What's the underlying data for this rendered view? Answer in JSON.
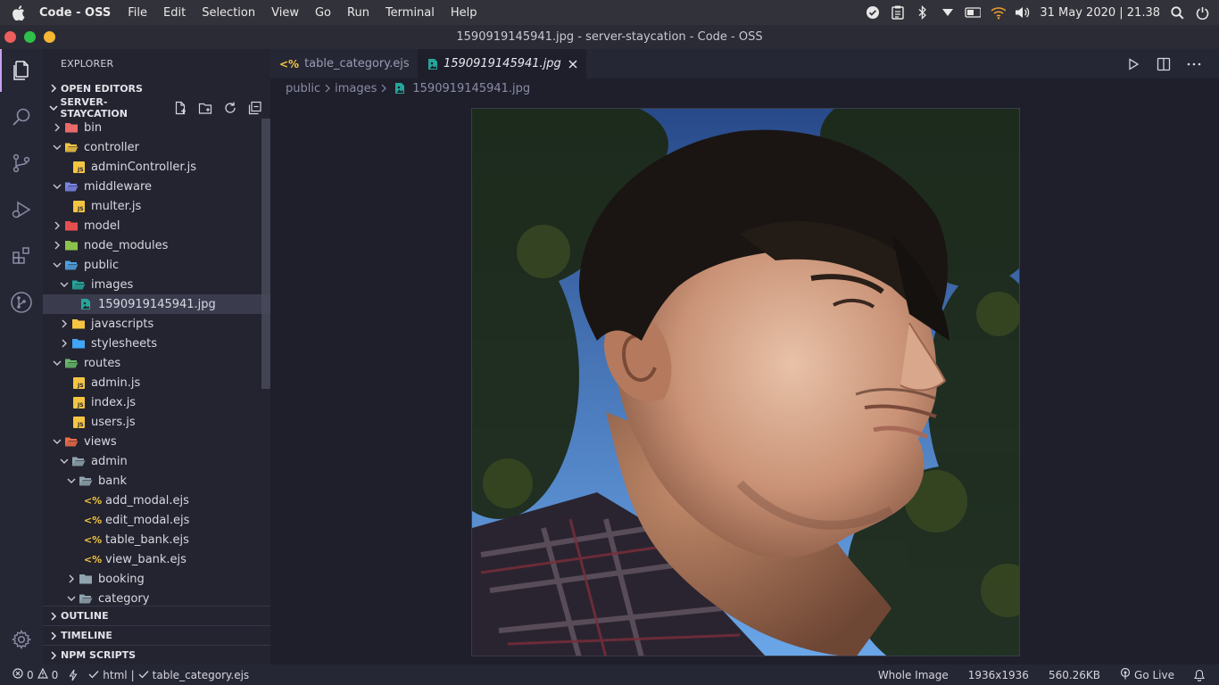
{
  "topbar": {
    "app_name": "Code - OSS",
    "menu": [
      "File",
      "Edit",
      "Selection",
      "View",
      "Go",
      "Run",
      "Terminal",
      "Help"
    ],
    "clock": "31 May 2020 | 21.38"
  },
  "window": {
    "title": "1590919145941.jpg - server-staycation - Code - OSS",
    "lights": [
      "#ee5e5c",
      "#2ec04a",
      "#f5b633"
    ]
  },
  "sidebar": {
    "title": "EXPLORER",
    "open_editors": "OPEN EDITORS",
    "project": "SERVER-STAYCATION",
    "tree": [
      {
        "label": "bin",
        "depth": 0,
        "kind": "folder",
        "open": false,
        "color": "#e96a6a"
      },
      {
        "label": "controller",
        "depth": 0,
        "kind": "folder",
        "open": true,
        "color": "#f5c542"
      },
      {
        "label": "adminController.js",
        "depth": 1,
        "kind": "js"
      },
      {
        "label": "middleware",
        "depth": 0,
        "kind": "folder",
        "open": true,
        "color": "#7b86e8"
      },
      {
        "label": "multer.js",
        "depth": 1,
        "kind": "js"
      },
      {
        "label": "model",
        "depth": 0,
        "kind": "folder",
        "open": false,
        "color": "#e64f4f"
      },
      {
        "label": "node_modules",
        "depth": 0,
        "kind": "folder",
        "open": false,
        "color": "#8bc34a"
      },
      {
        "label": "public",
        "depth": 0,
        "kind": "folder",
        "open": true,
        "color": "#4fa3e3"
      },
      {
        "label": "images",
        "depth": 1,
        "kind": "folder",
        "open": true,
        "color": "#26a69a"
      },
      {
        "label": "1590919145941.jpg",
        "depth": 2,
        "kind": "img",
        "selected": true
      },
      {
        "label": "javascripts",
        "depth": 1,
        "kind": "folder",
        "open": false,
        "color": "#f5c542"
      },
      {
        "label": "stylesheets",
        "depth": 1,
        "kind": "folder",
        "open": false,
        "color": "#42a5f5"
      },
      {
        "label": "routes",
        "depth": 0,
        "kind": "folder",
        "open": true,
        "color": "#66bb6a"
      },
      {
        "label": "admin.js",
        "depth": 1,
        "kind": "js"
      },
      {
        "label": "index.js",
        "depth": 1,
        "kind": "js"
      },
      {
        "label": "users.js",
        "depth": 1,
        "kind": "js"
      },
      {
        "label": "views",
        "depth": 0,
        "kind": "folder",
        "open": true,
        "color": "#ef6c4a"
      },
      {
        "label": "admin",
        "depth": 1,
        "kind": "folder",
        "open": true,
        "color": "#90a4ae"
      },
      {
        "label": "bank",
        "depth": 2,
        "kind": "folder",
        "open": true,
        "color": "#90a4ae"
      },
      {
        "label": "add_modal.ejs",
        "depth": 3,
        "kind": "ejs"
      },
      {
        "label": "edit_modal.ejs",
        "depth": 3,
        "kind": "ejs"
      },
      {
        "label": "table_bank.ejs",
        "depth": 3,
        "kind": "ejs"
      },
      {
        "label": "view_bank.ejs",
        "depth": 3,
        "kind": "ejs"
      },
      {
        "label": "booking",
        "depth": 2,
        "kind": "folder",
        "open": false,
        "color": "#90a4ae"
      },
      {
        "label": "category",
        "depth": 2,
        "kind": "folder",
        "open": true,
        "color": "#90a4ae"
      }
    ],
    "outline": "OUTLINE",
    "timeline": "TIMELINE",
    "npm_scripts": "NPM SCRIPTS"
  },
  "editor": {
    "tabs": [
      {
        "label": "table_category.ejs",
        "active": false
      },
      {
        "label": "1590919145941.jpg",
        "active": true
      }
    ],
    "breadcrumb": [
      "public",
      "images",
      "1590919145941.jpg"
    ]
  },
  "statusbar": {
    "errors": "0",
    "warnings": "0",
    "language": "html",
    "file": "table_category.ejs",
    "zoom": "Whole Image",
    "dimensions": "1936x1936",
    "size": "560.26KB",
    "golive": "Go Live"
  }
}
